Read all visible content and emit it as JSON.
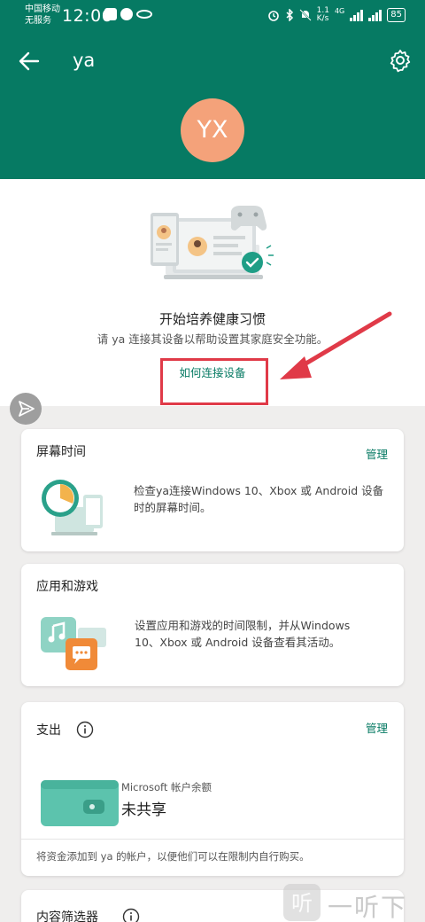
{
  "status_bar": {
    "carrier_line1": "中国移动",
    "carrier_line2": "无服务",
    "time": "12:06",
    "speed_value": "1.1",
    "speed_unit": "K/s",
    "network": "4G",
    "battery": "85"
  },
  "app_bar": {
    "title": "ya",
    "avatar_initials": "YX"
  },
  "hero": {
    "title": "开始培养健康习惯",
    "subtitle": "请 ya 连接其设备以帮助设置其家庭安全功能。",
    "link": "如何连接设备"
  },
  "screen_time": {
    "title": "屏幕时间",
    "action": "管理",
    "description_line1": "检查ya连接Windows 10、Xbox 或 Android 设备",
    "description_line2": "时的屏幕时间。"
  },
  "apps_games": {
    "title": "应用和游戏",
    "description_line1": "设置应用和游戏的时间限制，并从Windows",
    "description_line2": "10、Xbox 或 Android 设备查看其活动。"
  },
  "spending": {
    "title": "支出",
    "action": "管理",
    "balance_label": "Microsoft 帐户余额",
    "balance_value": "未共享",
    "footer": "将资金添加到 ya 的帐户，以便他们可以在限制内自行购买。"
  },
  "content_filter": {
    "title": "内容筛选器"
  },
  "watermark": {
    "text": "一听下载"
  },
  "colors": {
    "brand": "#067a63",
    "avatar": "#f4a27a",
    "highlight": "#e03a48"
  }
}
